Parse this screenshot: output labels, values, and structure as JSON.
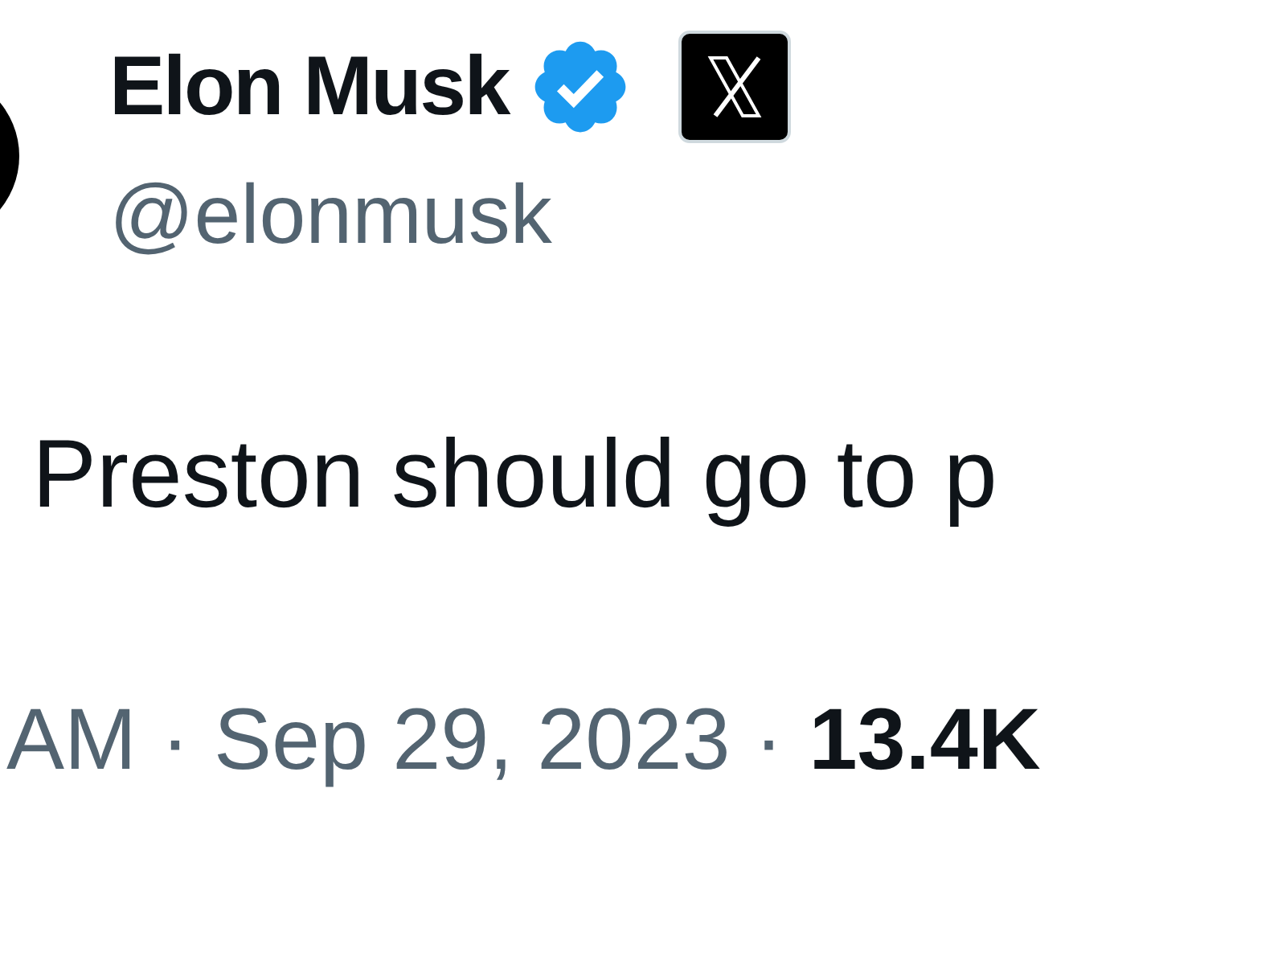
{
  "author": {
    "name": "Elon Musk",
    "verified": true,
    "handle": "@elonmusk"
  },
  "tweet": {
    "text": "Preston should go to p"
  },
  "meta": {
    "time_date": "AM · Sep 29, 2023 ·",
    "views": "13.4K"
  }
}
